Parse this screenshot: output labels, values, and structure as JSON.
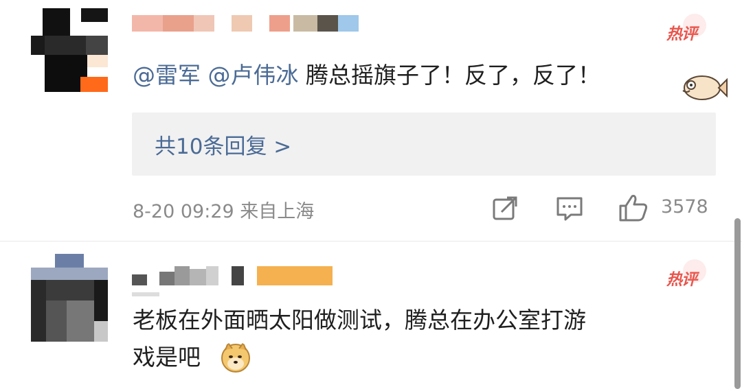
{
  "comment1": {
    "badge": "热评",
    "mentions": [
      "@雷军",
      "@卢伟冰"
    ],
    "text": "腾总摇旗子了！反了，反了！",
    "reply_link": "共10条回复 >",
    "timestamp": "8-20 09:29",
    "location": "来自上海",
    "like_count": "3578"
  },
  "comment2": {
    "badge": "热评",
    "text_line1": "老板在外面晒太阳做测试，腾总在办公室打游",
    "text_line2": "戏是吧"
  },
  "icons": {
    "share": "share-icon",
    "comment": "comment-icon",
    "like": "like-icon",
    "fish_emoji": "fish-emoji-icon",
    "doge_emoji": "doge-emoji-icon"
  },
  "colors": {
    "link": "#4b6b95",
    "hot_badge": "#e8554c",
    "meta": "#8a8a8a"
  }
}
